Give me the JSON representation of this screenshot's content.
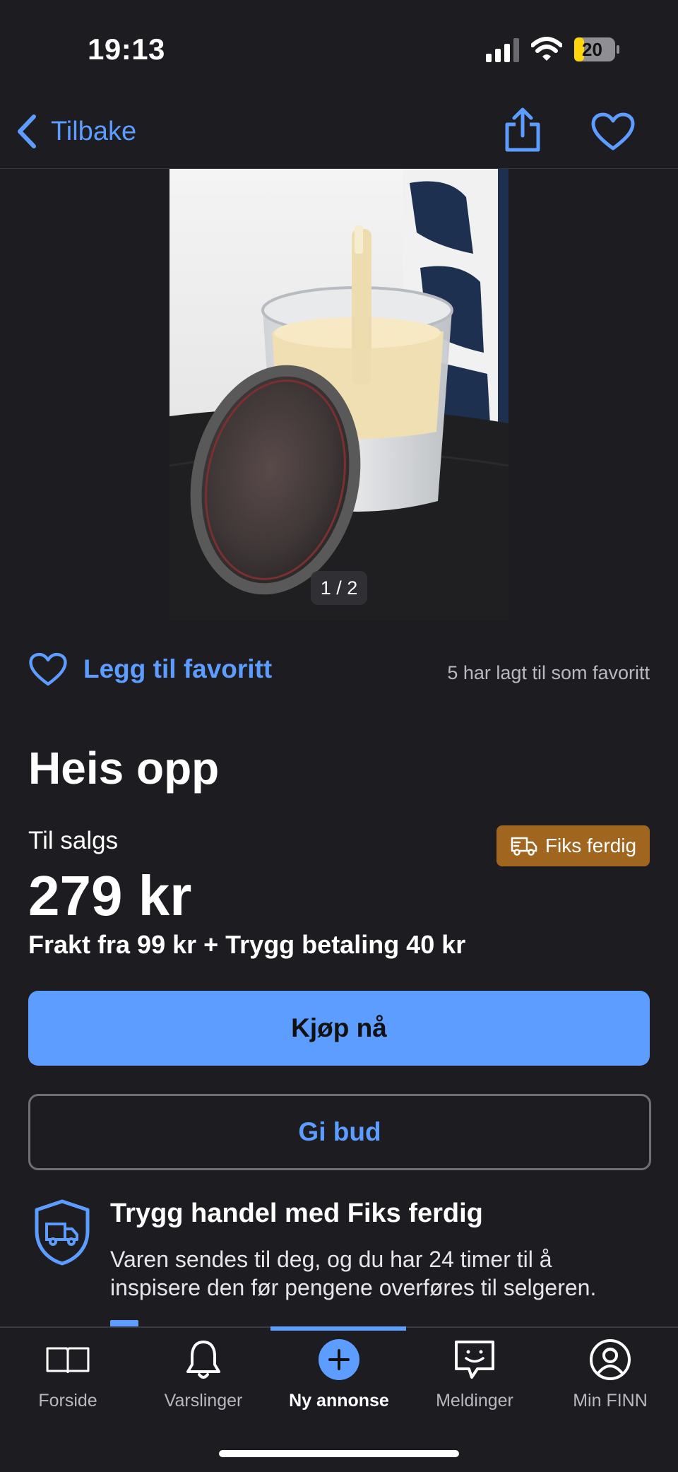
{
  "status_bar": {
    "time": "19:13",
    "battery": "20"
  },
  "nav": {
    "back_label": "Tilbake",
    "share_icon": "share-icon",
    "favorite_icon": "heart-icon"
  },
  "gallery": {
    "pager": "1 / 2"
  },
  "favorite": {
    "label": "Legg til favoritt",
    "count_text": "5 har lagt til som favoritt"
  },
  "listing": {
    "title": "Heis opp",
    "status": "Til salgs",
    "badge": "Fiks ferdig",
    "price": "279 kr",
    "shipping": "Frakt fra 99 kr + Trygg betaling 40 kr"
  },
  "actions": {
    "buy_label": "Kjøp nå",
    "bid_label": "Gi bud"
  },
  "safe_trade": {
    "title": "Trygg handel med Fiks ferdig",
    "description": "Varen sendes til deg, og du har 24 timer til å inspisere den før pengene overføres til selgeren."
  },
  "tabbar": {
    "items": [
      {
        "label": "Forside",
        "icon": "book-icon"
      },
      {
        "label": "Varslinger",
        "icon": "bell-icon"
      },
      {
        "label": "Ny annonse",
        "icon": "plus-icon"
      },
      {
        "label": "Meldinger",
        "icon": "chat-icon"
      },
      {
        "label": "Min FINN",
        "icon": "profile-icon"
      }
    ],
    "active_index": 2
  },
  "colors": {
    "accent": "#5c9dff",
    "background": "#1c1c21",
    "badge": "#a0651e"
  }
}
